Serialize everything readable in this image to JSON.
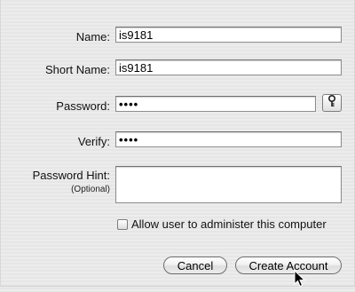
{
  "form": {
    "name": {
      "label": "Name:",
      "value": "is9181"
    },
    "short_name": {
      "label": "Short Name:",
      "value": "is9181"
    },
    "password": {
      "label": "Password:",
      "value": "••••"
    },
    "verify": {
      "label": "Verify:",
      "value": "••••"
    },
    "password_hint": {
      "label": "Password Hint:",
      "sublabel": "(Optional)",
      "value": ""
    }
  },
  "admin_checkbox": {
    "label": "Allow user to administer this computer",
    "checked": false
  },
  "buttons": {
    "cancel": "Cancel",
    "create": "Create Account"
  },
  "icons": {
    "password_assistant": "key-icon",
    "cursor": "pointer-arrow-icon"
  }
}
